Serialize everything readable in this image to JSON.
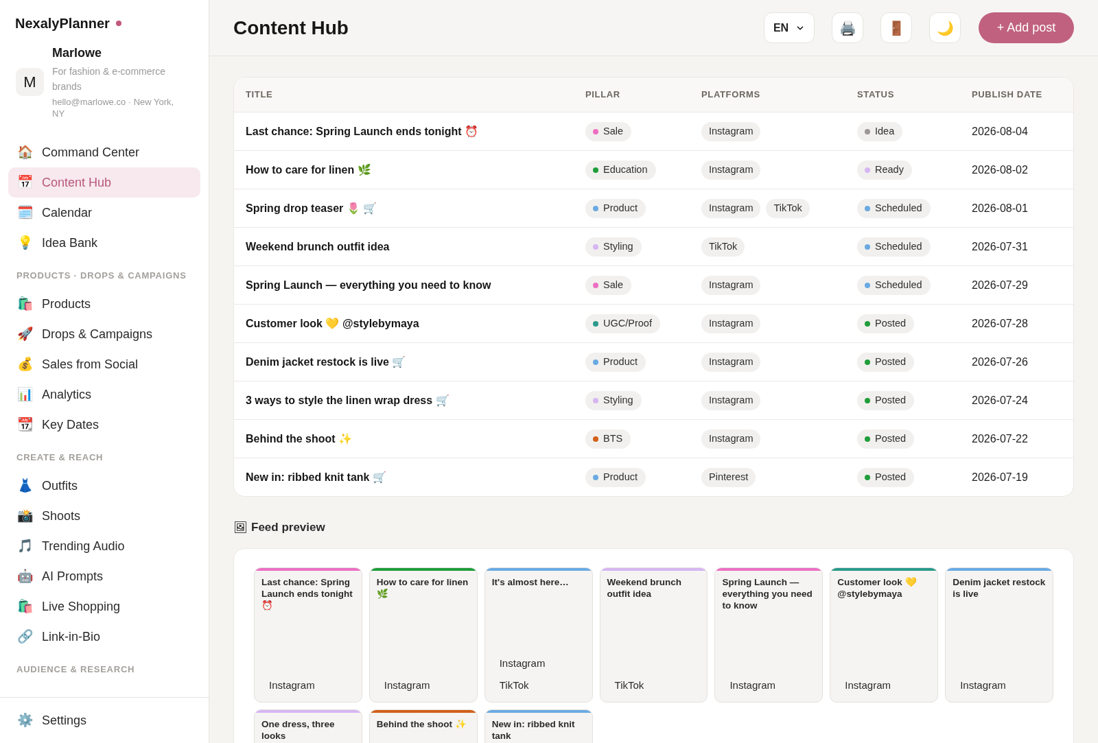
{
  "sidebar": {
    "brand": "NexalyPlanner",
    "profile": {
      "initial": "M",
      "name": "Marlowe",
      "tagline": "For fashion & e-commerce brands",
      "contact": "hello@marlowe.co · New York, NY"
    },
    "nav_groups": [
      {
        "items": [
          {
            "icon": "🏠",
            "label": "Command Center",
            "selected": false
          },
          {
            "icon": "📅",
            "label": "Content Hub",
            "selected": true
          },
          {
            "icon": "🗓️",
            "label": "Calendar",
            "selected": false
          },
          {
            "icon": "💡",
            "label": "Idea Bank",
            "selected": false
          }
        ]
      },
      {
        "heading": "PRODUCTS · DROPS & CAMPAIGNS",
        "items": [
          {
            "icon": "🛍️",
            "label": "Products",
            "selected": false
          },
          {
            "icon": "🚀",
            "label": "Drops & Campaigns",
            "selected": false
          },
          {
            "icon": "💰",
            "label": "Sales from Social",
            "selected": false
          },
          {
            "icon": "📊",
            "label": "Analytics",
            "selected": false
          },
          {
            "icon": "📆",
            "label": "Key Dates",
            "selected": false
          }
        ]
      },
      {
        "heading": "CREATE & REACH",
        "items": [
          {
            "icon": "👗",
            "label": "Outfits",
            "selected": false
          },
          {
            "icon": "📸",
            "label": "Shoots",
            "selected": false
          },
          {
            "icon": "🎵",
            "label": "Trending Audio",
            "selected": false
          },
          {
            "icon": "🤖",
            "label": "AI Prompts",
            "selected": false
          },
          {
            "icon": "🛍️",
            "label": "Live Shopping",
            "selected": false
          },
          {
            "icon": "🔗",
            "label": "Link-in-Bio",
            "selected": false
          }
        ]
      },
      {
        "heading": "AUDIENCE & RESEARCH"
      }
    ],
    "footer_item": {
      "icon": "⚙️",
      "label": "Settings",
      "selected": false
    }
  },
  "header": {
    "title": "Content Hub",
    "language": "EN",
    "actions": [
      {
        "icon": "🖨️"
      },
      {
        "icon": "🚪"
      },
      {
        "icon": "🌙"
      }
    ],
    "add_button": "+ Add post"
  },
  "table": {
    "columns": [
      "TITLE",
      "PILLAR",
      "PLATFORMS",
      "STATUS",
      "PUBLISH DATE"
    ],
    "rows": [
      {
        "title": "Last chance: Spring Launch ends tonight ⏰",
        "pillar": {
          "label": "Sale",
          "color": "#ec6fc2"
        },
        "platforms": [
          "Instagram"
        ],
        "status": {
          "label": "Idea",
          "color": "#9a9794"
        },
        "date": "2026-08-04"
      },
      {
        "title": "How to care for linen 🌿",
        "pillar": {
          "label": "Education",
          "color": "#1f9d3a"
        },
        "platforms": [
          "Instagram"
        ],
        "status": {
          "label": "Ready",
          "color": "#d6b6f2"
        },
        "date": "2026-08-02"
      },
      {
        "title": "Spring drop teaser 🌷 🛒",
        "pillar": {
          "label": "Product",
          "color": "#6aaae2"
        },
        "platforms": [
          "Instagram",
          "TikTok"
        ],
        "status": {
          "label": "Scheduled",
          "color": "#6aaae2"
        },
        "date": "2026-08-01"
      },
      {
        "title": "Weekend brunch outfit idea",
        "pillar": {
          "label": "Styling",
          "color": "#d6b6f2"
        },
        "platforms": [
          "TikTok"
        ],
        "status": {
          "label": "Scheduled",
          "color": "#6aaae2"
        },
        "date": "2026-07-31"
      },
      {
        "title": "Spring Launch — everything you need to know",
        "pillar": {
          "label": "Sale",
          "color": "#ec6fc2"
        },
        "platforms": [
          "Instagram"
        ],
        "status": {
          "label": "Scheduled",
          "color": "#6aaae2"
        },
        "date": "2026-07-29"
      },
      {
        "title": "Customer look 💛 @stylebymaya",
        "pillar": {
          "label": "UGC/Proof",
          "color": "#2a9a8c"
        },
        "platforms": [
          "Instagram"
        ],
        "status": {
          "label": "Posted",
          "color": "#1f9d3a"
        },
        "date": "2026-07-28"
      },
      {
        "title": "Denim jacket restock is live 🛒",
        "pillar": {
          "label": "Product",
          "color": "#6aaae2"
        },
        "platforms": [
          "Instagram"
        ],
        "status": {
          "label": "Posted",
          "color": "#1f9d3a"
        },
        "date": "2026-07-26"
      },
      {
        "title": "3 ways to style the linen wrap dress 🛒",
        "pillar": {
          "label": "Styling",
          "color": "#d6b6f2"
        },
        "platforms": [
          "Instagram"
        ],
        "status": {
          "label": "Posted",
          "color": "#1f9d3a"
        },
        "date": "2026-07-24"
      },
      {
        "title": "Behind the shoot ✨",
        "pillar": {
          "label": "BTS",
          "color": "#d2601a"
        },
        "platforms": [
          "Instagram"
        ],
        "status": {
          "label": "Posted",
          "color": "#1f9d3a"
        },
        "date": "2026-07-22"
      },
      {
        "title": "New in: ribbed knit tank 🛒",
        "pillar": {
          "label": "Product",
          "color": "#6aaae2"
        },
        "platforms": [
          "Pinterest"
        ],
        "status": {
          "label": "Posted",
          "color": "#1f9d3a"
        },
        "date": "2026-07-19"
      }
    ]
  },
  "feed_preview": {
    "icon": "🖼",
    "heading": "Feed preview",
    "tiles": [
      {
        "title": "Last chance: Spring Launch ends tonight ⏰",
        "color": "#ec6fc2",
        "platforms": [
          "Instagram"
        ]
      },
      {
        "title": "How to care for linen 🌿",
        "color": "#1f9d3a",
        "platforms": [
          "Instagram"
        ]
      },
      {
        "title": "It's almost here…",
        "color": "#6aaae2",
        "platforms": [
          "Instagram",
          "TikTok"
        ]
      },
      {
        "title": "Weekend brunch outfit idea",
        "color": "#d6b6f2",
        "platforms": [
          "TikTok"
        ]
      },
      {
        "title": "Spring Launch — everything you need to know",
        "color": "#ec6fc2",
        "platforms": [
          "Instagram"
        ]
      },
      {
        "title": "Customer look 💛 @stylebymaya",
        "color": "#2a9a8c",
        "platforms": [
          "Instagram"
        ]
      },
      {
        "title": "Denim jacket restock is live",
        "color": "#6aaae2",
        "platforms": [
          "Instagram"
        ]
      },
      {
        "title": "One dress, three looks",
        "color": "#d6b6f2"
      },
      {
        "title": "Behind the shoot ✨",
        "color": "#d2601a"
      },
      {
        "title": "New in: ribbed knit tank",
        "color": "#6aaae2"
      }
    ]
  }
}
